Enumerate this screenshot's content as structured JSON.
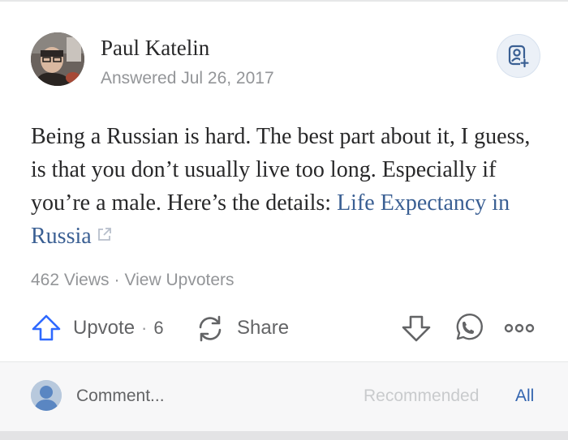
{
  "author": {
    "name": "Paul Katelin",
    "answered": "Answered Jul 26, 2017"
  },
  "answer": {
    "text": "Being a Russian is hard. The best part about it, I guess, is that you don’t usually live too long. Especially if you’re a male. Here’s the details:",
    "link_text": "Life Expectancy in Russia"
  },
  "stats": {
    "views": "462 Views",
    "separator": "·",
    "upvoters": "View Upvoters"
  },
  "actions": {
    "upvote_label": "Upvote",
    "separator": "·",
    "upvote_count": "6",
    "share_label": "Share"
  },
  "comment": {
    "placeholder": "Comment...",
    "sort_recommended": "Recommended",
    "sort_all": "All"
  },
  "icons": {
    "follow": "follow-person-plus-icon",
    "external_link": "external-link-icon",
    "upvote": "arrow-up-icon",
    "share": "share-cycle-icon",
    "downvote": "arrow-down-icon",
    "whatsapp": "whatsapp-icon",
    "more": "more-dots-icon"
  },
  "colors": {
    "link": "#3a5f93",
    "upvote_blue": "#2e69ff",
    "muted": "#939598",
    "text": "#282829"
  }
}
